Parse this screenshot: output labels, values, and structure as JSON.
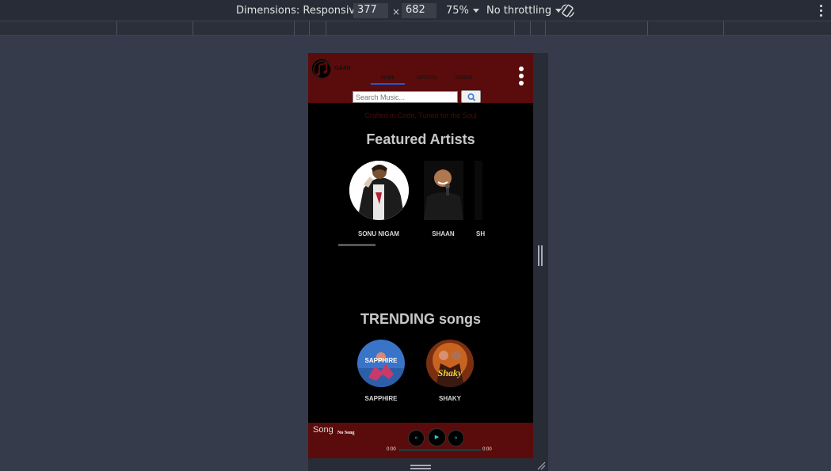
{
  "devtools": {
    "dimensions_label": "Dimensions: Responsive",
    "width": "377",
    "times": "×",
    "height": "682",
    "zoom": "75%",
    "throttling": "No throttling"
  },
  "app": {
    "logo_text": "GAAN",
    "nav": [
      "HOME",
      "ARTISTS",
      "SONGS"
    ],
    "search": {
      "placeholder": "Search Music...",
      "button_icon": "search-icon"
    },
    "tagline": "Crafted in Code, Tuned for the Soul",
    "featured_title": "Featured Artists",
    "artists": [
      {
        "name": "SONU NIGAM"
      },
      {
        "name": "SHAAN"
      },
      {
        "name": "SH"
      }
    ],
    "trending_title": "TRENDING songs",
    "songs": [
      {
        "name": "SAPPHIRE",
        "art_text": "SAPPHIRE"
      },
      {
        "name": "SHAKY",
        "art_text": "Shaky"
      }
    ],
    "player": {
      "image_alt": "Song",
      "title": "No Song",
      "prev": "«",
      "play": "▶",
      "next": "»",
      "current_time": "0:00",
      "duration": "0:00",
      "progress": 0
    }
  },
  "colors": {
    "header_bg": "#5a0b0b",
    "nav_active": "#1e5bd6",
    "control_accent": "#1fd0e0"
  }
}
